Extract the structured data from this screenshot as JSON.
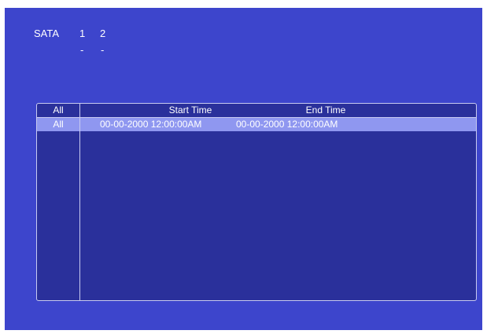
{
  "disks": {
    "label": "SATA",
    "numbers": [
      "1",
      "2"
    ],
    "status": [
      "-",
      "-"
    ]
  },
  "table": {
    "headers": {
      "all": "All",
      "start_time": "Start Time",
      "end_time": "End Time"
    },
    "rows": [
      {
        "all": "All",
        "start_time": "00-00-2000 12:00:00AM",
        "end_time": "00-00-2000 12:00:00AM"
      }
    ]
  },
  "colors": {
    "background": "#3d45cc",
    "table_bg": "#2a309b",
    "selected_row": "#8f97f0",
    "text": "#ffffff"
  }
}
